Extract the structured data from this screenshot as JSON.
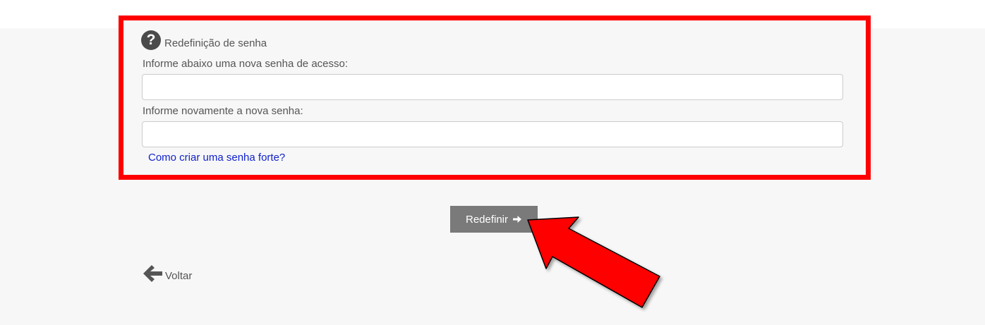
{
  "form": {
    "title": "Redefinição de senha",
    "help_icon": "question-circle-icon",
    "new_password_label": "Informe abaixo uma nova senha de acesso:",
    "new_password_value": "",
    "confirm_password_label": "Informe novamente a nova senha:",
    "confirm_password_value": "",
    "strong_password_link": "Como criar uma senha forte?"
  },
  "actions": {
    "submit_label": "Redefinir",
    "submit_icon": "arrow-right-icon",
    "back_label": "Voltar",
    "back_icon": "arrow-left-icon"
  },
  "annotation": {
    "highlight_color": "#ff0000",
    "arrow_color": "#ff0000"
  },
  "colors": {
    "background": "#f7f7f7",
    "button": "#7a7a7a",
    "link": "#1122cc",
    "text": "#555555"
  }
}
